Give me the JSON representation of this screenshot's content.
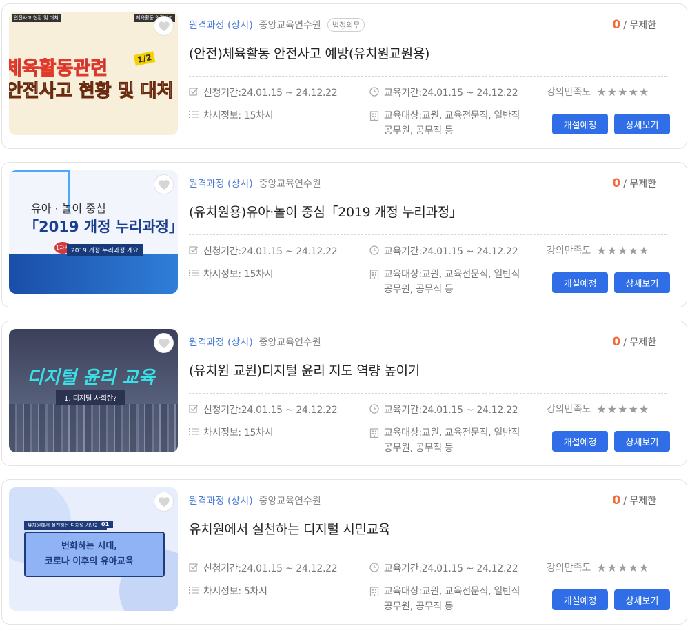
{
  "courses": [
    {
      "category": "원격과정 (상시)",
      "org": "중앙교육연수원",
      "badge": "법정의무",
      "count": "0",
      "limit": "/ 무제한",
      "title": "(안전)체육활동 안전사고 예방(유치원교원용)",
      "period_label": "신청기간:24.01.15 ~ 24.12.22",
      "edu_label": "교육기간:24.01.15 ~ 24.12.22",
      "rating_label": "강의만족도",
      "stars": "★★★★★",
      "sessions_label": "차시정보: 15차시",
      "target_line1": "교육대상:교원, 교육전문직, 일반직",
      "target_line2": "공무원, 공무직 등",
      "open_button": "개설예정",
      "detail_button": "상세보기",
      "thumb": {
        "top_left": "안전사고 현황 및 대처",
        "top_right": "체육활동 안전사고",
        "line1": "체육활동관련",
        "line2": "안전사고 현황 및 대처",
        "num": "1/2"
      }
    },
    {
      "category": "원격과정 (상시)",
      "org": "중앙교육연수원",
      "badge": "",
      "count": "0",
      "limit": "/ 무제한",
      "title": "(유치원용)유아·놀이 중심「2019 개정 누리과정」",
      "period_label": "신청기간:24.01.15 ~ 24.12.22",
      "edu_label": "교육기간:24.01.15 ~ 24.12.22",
      "rating_label": "강의만족도",
      "stars": "★★★★★",
      "sessions_label": "차시정보: 15차시",
      "target_line1": "교육대상:교원, 교육전문직, 일반직",
      "target_line2": "공무원, 공무직 등",
      "open_button": "개설예정",
      "detail_button": "상세보기",
      "thumb": {
        "line1": "유아 · 놀이 중심",
        "line2": "「2019 개정 누리과정」",
        "num": "1차시",
        "sub": "2019 개정 누리과정 개요"
      }
    },
    {
      "category": "원격과정 (상시)",
      "org": "중앙교육연수원",
      "badge": "",
      "count": "0",
      "limit": "/ 무제한",
      "title": "(유치원 교원)디지털 윤리 지도 역량 높이기",
      "period_label": "신청기간:24.01.15 ~ 24.12.22",
      "edu_label": "교육기간:24.01.15 ~ 24.12.22",
      "rating_label": "강의만족도",
      "stars": "★★★★★",
      "sessions_label": "차시정보: 15차시",
      "target_line1": "교육대상:교원, 교육전문직, 일반직",
      "target_line2": "공무원, 공무직 등",
      "open_button": "개설예정",
      "detail_button": "상세보기",
      "thumb": {
        "line1": "디지털 윤리 교육",
        "sub": "1. 디지털 사회란?"
      }
    },
    {
      "category": "원격과정 (상시)",
      "org": "중앙교육연수원",
      "badge": "",
      "count": "0",
      "limit": "/ 무제한",
      "title": "유치원에서 실천하는 디지털 시민교육",
      "period_label": "신청기간:24.01.15 ~ 24.12.22",
      "edu_label": "교육기간:24.01.15 ~ 24.12.22",
      "rating_label": "강의만족도",
      "stars": "★★★★★",
      "sessions_label": "차시정보: 5차시",
      "target_line1": "교육대상:교원, 교육전문직, 일반직",
      "target_line2": "공무원, 공무직 등",
      "open_button": "개설예정",
      "detail_button": "상세보기",
      "thumb": {
        "tag": "유치원에서 실천하는 디지털 시민교육",
        "num": "01",
        "line1": "변화하는 시대,",
        "line2": "코로나 이후의 유아교육"
      }
    }
  ],
  "colors": {
    "accent": "#2f6ee6",
    "count": "#f26b3a",
    "category": "#4a7bd6"
  }
}
